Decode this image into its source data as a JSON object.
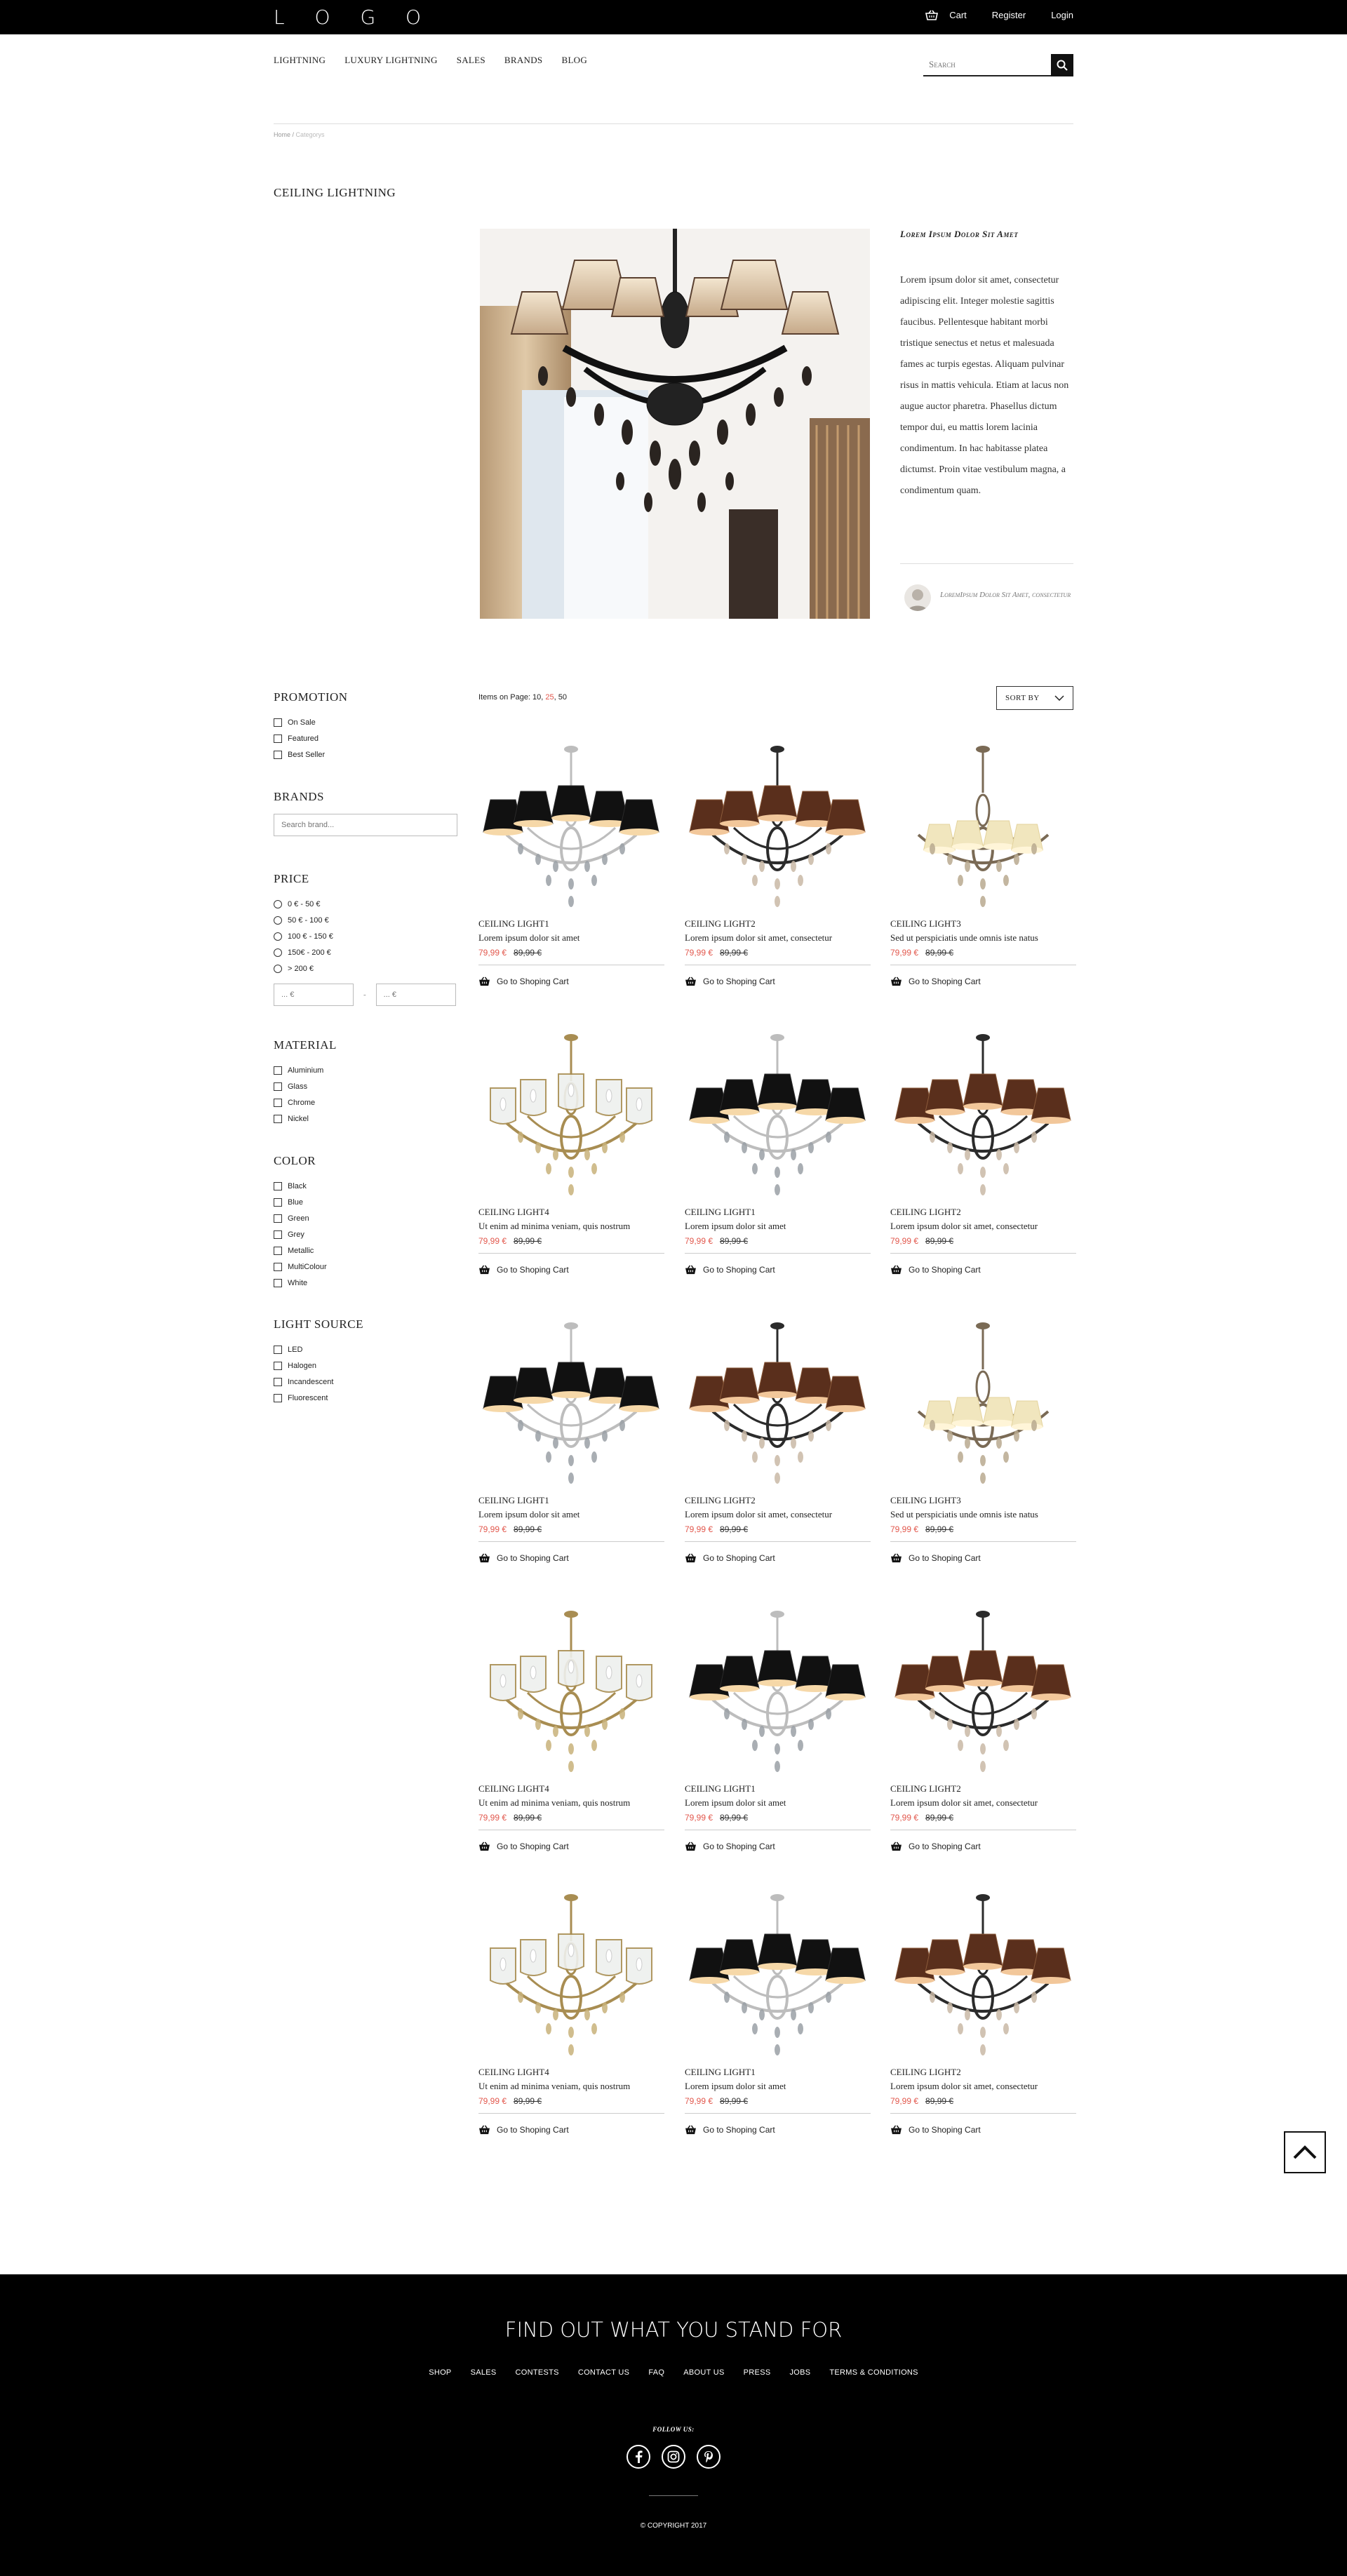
{
  "header": {
    "logo": "L O G O",
    "cart": "Cart",
    "register": "Register",
    "login": "Login"
  },
  "nav": {
    "items": [
      "LIGHTNING",
      "LUXURY LIGHTNING",
      "SALES",
      "BRANDS",
      "BLOG"
    ],
    "search_placeholder": "Search"
  },
  "breadcrumb": {
    "home": "Home",
    "separator": " / ",
    "current": "Categorys"
  },
  "page": {
    "title": "CEILING LIGHTNING"
  },
  "aside": {
    "title": "Lorem Ipsum Dolor Sit Amet",
    "text": "Lorem ipsum dolor sit amet, consectetur adipiscing elit. Integer molestie sagittis faucibus. Pellentesque habitant morbi tristique senectus et netus et malesuada fames ac turpis egestas. Aliquam pulvinar risus in mattis vehicula. Etiam at lacus non augue auctor pharetra. Phasellus dictum tempor dui, eu mattis lorem lacinia condimentum. In hac habitasse platea dictumst. Proin vitae vestibulum magna, a condimentum quam.",
    "quote": "LoremIpsum Dolor Sit Amet, consectetur"
  },
  "filters": {
    "promotion": {
      "title": "PROMOTION",
      "options": [
        "On Sale",
        "Featured",
        "Best Seller"
      ]
    },
    "brands": {
      "title": "BRANDS",
      "placeholder": "Search brand..."
    },
    "price": {
      "title": "PRICE",
      "options": [
        "0 € - 50 €",
        "50 € - 100 €",
        "100 € - 150 €",
        "150€ - 200 €",
        "> 200 €"
      ],
      "from_placeholder": "... €",
      "dash": "-",
      "to_placeholder": "... €"
    },
    "material": {
      "title": "MATERIAL",
      "options": [
        "Aluminium",
        "Glass",
        "Chrome",
        "Nickel"
      ]
    },
    "color": {
      "title": "COLOR",
      "options": [
        "Black",
        "Blue",
        "Green",
        "Grey",
        "Metallic",
        "MultiColour",
        "White"
      ]
    },
    "light_source": {
      "title": "LIGHT SOURCE",
      "options": [
        "LED",
        "Halogen",
        "Incandescent",
        "Fluorescent"
      ]
    }
  },
  "toolbar": {
    "items_label": "Items on Page: ",
    "page_sizes": [
      "10",
      "25",
      "50"
    ],
    "active_size": "25",
    "sort_label": "SORT BY"
  },
  "products": [
    {
      "name": "CEILING LIGHT1",
      "desc": "Lorem ipsum dolor sit amet",
      "price": "79,99 €",
      "old_price": "89,99 €",
      "cart": "Go to Shoping Cart",
      "style": "black"
    },
    {
      "name": "CEILING LIGHT2",
      "desc": "Lorem ipsum dolor sit amet, consectetur",
      "price": "79,99 €",
      "old_price": "89,99 €",
      "cart": "Go to Shoping Cart",
      "style": "bronze"
    },
    {
      "name": "CEILING LIGHT3",
      "desc": "Sed ut perspiciatis unde omnis iste natus",
      "price": "79,99 €",
      "old_price": "89,99 €",
      "cart": "Go to Shoping Cart",
      "style": "cream"
    },
    {
      "name": "CEILING LIGHT4",
      "desc": "Ut enim ad minima veniam, quis nostrum",
      "price": "79,99 €",
      "old_price": "89,99 €",
      "cart": "Go to Shoping Cart",
      "style": "gold"
    },
    {
      "name": "CEILING LIGHT1",
      "desc": "Lorem ipsum dolor sit amet",
      "price": "79,99 €",
      "old_price": "89,99 €",
      "cart": "Go to Shoping Cart",
      "style": "black"
    },
    {
      "name": "CEILING LIGHT2",
      "desc": "Lorem ipsum dolor sit amet, consectetur",
      "price": "79,99 €",
      "old_price": "89,99 €",
      "cart": "Go to Shoping Cart",
      "style": "bronze"
    },
    {
      "name": "CEILING LIGHT1",
      "desc": "Lorem ipsum dolor sit amet",
      "price": "79,99 €",
      "old_price": "89,99 €",
      "cart": "Go to Shoping Cart",
      "style": "black"
    },
    {
      "name": "CEILING LIGHT2",
      "desc": "Lorem ipsum dolor sit amet, consectetur",
      "price": "79,99 €",
      "old_price": "89,99 €",
      "cart": "Go to Shoping Cart",
      "style": "bronze"
    },
    {
      "name": "CEILING LIGHT3",
      "desc": "Sed ut perspiciatis unde omnis iste natus",
      "price": "79,99 €",
      "old_price": "89,99 €",
      "cart": "Go to Shoping Cart",
      "style": "cream"
    },
    {
      "name": "CEILING LIGHT4",
      "desc": "Ut enim ad minima veniam, quis nostrum",
      "price": "79,99 €",
      "old_price": "89,99 €",
      "cart": "Go to Shoping Cart",
      "style": "gold"
    },
    {
      "name": "CEILING LIGHT1",
      "desc": "Lorem ipsum dolor sit amet",
      "price": "79,99 €",
      "old_price": "89,99 €",
      "cart": "Go to Shoping Cart",
      "style": "black"
    },
    {
      "name": "CEILING LIGHT2",
      "desc": "Lorem ipsum dolor sit amet, consectetur",
      "price": "79,99 €",
      "old_price": "89,99 €",
      "cart": "Go to Shoping Cart",
      "style": "bronze"
    },
    {
      "name": "CEILING LIGHT4",
      "desc": "Ut enim ad minima veniam, quis nostrum",
      "price": "79,99 €",
      "old_price": "89,99 €",
      "cart": "Go to Shoping Cart",
      "style": "gold"
    },
    {
      "name": "CEILING LIGHT1",
      "desc": "Lorem ipsum dolor sit amet",
      "price": "79,99 €",
      "old_price": "89,99 €",
      "cart": "Go to Shoping Cart",
      "style": "black"
    },
    {
      "name": "CEILING LIGHT2",
      "desc": "Lorem ipsum dolor sit amet, consectetur",
      "price": "79,99 €",
      "old_price": "89,99 €",
      "cart": "Go to Shoping Cart",
      "style": "bronze"
    }
  ],
  "footer": {
    "title": "FIND OUT WHAT YOU STAND FOR",
    "links": [
      "SHOP",
      "SALES",
      "CONTESTS",
      "CONTACT US",
      "FAQ",
      "ABOUT US",
      "PRESS",
      "JOBS",
      "TERMS & CONDITIONS"
    ],
    "follow": "FOLLOW US:",
    "socials": [
      "facebook-icon",
      "instagram-icon",
      "pinterest-icon"
    ],
    "copyright": "© COPYRIGHT 2017"
  },
  "colors": {
    "accent": "#e2574c",
    "black": "#000000"
  }
}
